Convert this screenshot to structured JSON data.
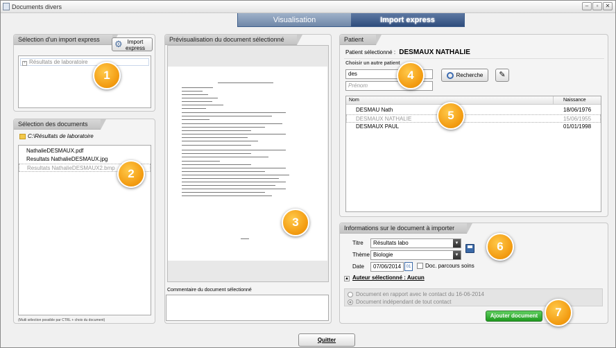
{
  "window": {
    "title": "Documents divers"
  },
  "tabs": [
    {
      "label": "Visualisation"
    },
    {
      "label": "Import express"
    }
  ],
  "import_panel": {
    "title": "Sélection d'un import express",
    "button": "Import express",
    "tree_item": "Résultats de laboratoire"
  },
  "docs_panel": {
    "title": "Sélection des documents",
    "folder": "C:\\Résultats de laboratoire",
    "files": [
      "NathalieDESMAUX.pdf",
      "Resultats NathalieDESMAUX.jpg",
      "Resultats NathalieDESMAUX2.bmp"
    ],
    "hint": "(Mutli sélection possible par CTRL + choix du document)"
  },
  "preview_panel": {
    "title": "Prévisualisation du document sélectionné",
    "comment_label": "Commentaire du document sélectionné"
  },
  "patient_panel": {
    "title": "Patient",
    "selected_label": "Patient sélectionné :",
    "selected_name": "DESMAUX NATHALIE",
    "other_label": "Choisir un autre patient",
    "name_value": "des",
    "prenom_placeholder": "Prénom",
    "search_button": "Recherche",
    "columns": [
      "Nom",
      "Naissance"
    ],
    "rows": [
      {
        "nom": "DESMAU Nath",
        "naissance": "18/06/1976"
      },
      {
        "nom": "DESMAUX NATHALIE",
        "naissance": "15/06/1955"
      },
      {
        "nom": "DESMAUX PAUL",
        "naissance": "01/01/1998"
      }
    ]
  },
  "info_panel": {
    "title": "Informations sur le document à importer",
    "titre_label": "Titre",
    "titre_value": "Résultats labo",
    "theme_label": "Thème",
    "theme_value": "Biologie",
    "date_label": "Date",
    "date_value": "07/06/2014",
    "parcours_label": "Doc. parcours soins",
    "auteur_label": "Auteur sélectionné : Aucun",
    "radio1": "Document en rapport avec le contact du 16-06-2014",
    "radio2": "Document indépendant de tout contact",
    "add_button": "Ajouter document"
  },
  "quit_button": "Quitter",
  "badges": [
    "1",
    "2",
    "3",
    "4",
    "5",
    "6",
    "7"
  ]
}
